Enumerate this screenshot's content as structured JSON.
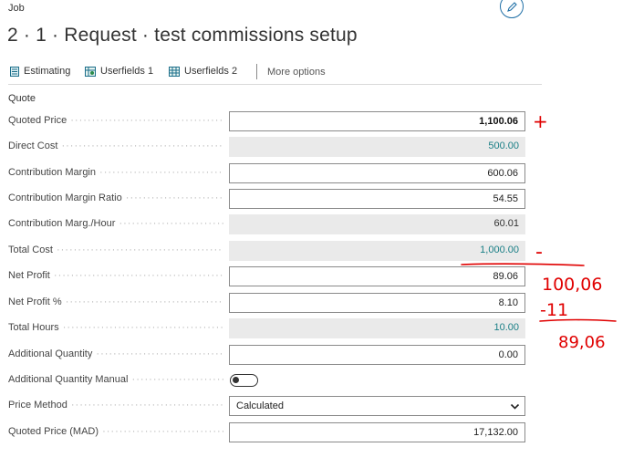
{
  "header": {
    "eyebrow": "Job",
    "title": "2 · 1 · Request · test commissions setup",
    "edit_icon": "pencil-icon"
  },
  "actions": [
    {
      "label": "Estimating",
      "icon": "sheet-icon"
    },
    {
      "label": "Userfields 1",
      "icon": "grid-user-icon"
    },
    {
      "label": "Userfields 2",
      "icon": "grid-icon"
    },
    {
      "label": "More options"
    }
  ],
  "section": "Quote",
  "fields": {
    "quoted_price": {
      "label": "Quoted Price",
      "value": "1,100.06"
    },
    "direct_cost": {
      "label": "Direct Cost",
      "value": "500.00"
    },
    "contribution_margin": {
      "label": "Contribution Margin",
      "value": "600.06"
    },
    "contribution_margin_ratio": {
      "label": "Contribution Margin Ratio",
      "value": "54.55"
    },
    "contribution_marg_hour": {
      "label": "Contribution Marg./Hour",
      "value": "60.01"
    },
    "total_cost": {
      "label": "Total Cost",
      "value": "1,000.00"
    },
    "net_profit": {
      "label": "Net Profit",
      "value": "89.06"
    },
    "net_profit_pct": {
      "label": "Net Profit %",
      "value": "8.10"
    },
    "total_hours": {
      "label": "Total Hours",
      "value": "10.00"
    },
    "additional_quantity": {
      "label": "Additional Quantity",
      "value": "0.00"
    },
    "additional_quantity_manual": {
      "label": "Additional Quantity Manual",
      "value": "off"
    },
    "price_method": {
      "label": "Price Method",
      "value": "Calculated"
    },
    "quoted_price_mad": {
      "label": "Quoted Price (MAD)",
      "value": "17,132.00"
    }
  },
  "annotations": {
    "plus": "+",
    "minus": "-",
    "line1": "100,06",
    "line2": "-11",
    "line3": "89,06",
    "color": "#e00000"
  },
  "colors": {
    "accent": "#1f6fa6",
    "readonly_value": "#1a7f86",
    "readonly_bg": "#eaeaea"
  }
}
